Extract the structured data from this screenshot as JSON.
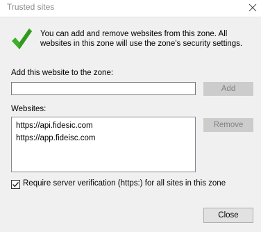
{
  "window": {
    "title": "Trusted sites",
    "close_icon": "close-icon"
  },
  "intro": {
    "icon": "checkmark-icon",
    "text": "You can add and remove websites from this zone. All websites in this zone will use the zone's security settings."
  },
  "add_section": {
    "label": "Add this website to the zone:",
    "input_value": "",
    "add_button": "Add"
  },
  "websites_section": {
    "label": "Websites:",
    "items": [
      "https://api.fidesic.com",
      "https://app.fideisc.com"
    ],
    "remove_button": "Remove"
  },
  "verification": {
    "checked": true,
    "label": "Require server verification (https:) for all sites in this zone"
  },
  "footer": {
    "close_button": "Close"
  },
  "colors": {
    "check_green": "#3fae2a",
    "disabled_button": "#cccccc",
    "dialog_bg": "#f0f0f0"
  }
}
